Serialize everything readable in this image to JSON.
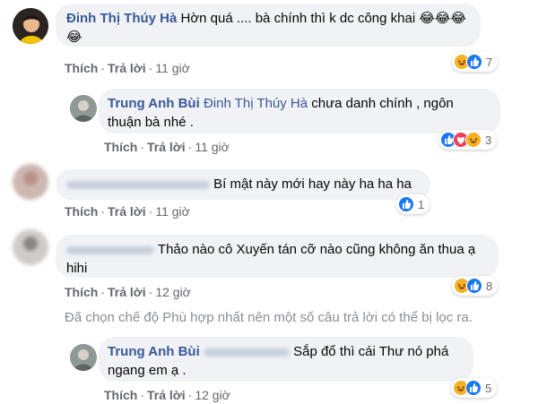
{
  "comments": [
    {
      "author": "Đinh Thị Thúy Hà",
      "text_line1": "Hờn quá .... bà chính thì k dc công khai",
      "emoji_text": "😂😂😂",
      "emoji_line2": "😂",
      "like": "Thích",
      "reply": "Trả lời",
      "time": "11 giờ",
      "reaction_icons": [
        "haha-icon",
        "like-icon"
      ],
      "reaction_count": "7"
    },
    {
      "author": "Trung Anh Bùi",
      "tagged": "Đinh Thị Thúy Hà",
      "text_line1": "chưa danh chính , ngôn",
      "text_line2": "thuận bà nhé .",
      "like": "Thích",
      "reply": "Trả lời",
      "time": "11 giờ",
      "reaction_icons": [
        "like-icon",
        "love-icon",
        "haha-icon"
      ],
      "reaction_count": "3"
    },
    {
      "author": "",
      "text_line1": "Bí mật này mới hay này ha ha ha",
      "like": "Thích",
      "reply": "Trả lời",
      "time": "11 giờ",
      "reaction_icons": [
        "like-icon"
      ],
      "reaction_count": "1"
    },
    {
      "author": "",
      "text_line1": "Thảo nào cô Xuyến tán cỡ nào cũng không ăn thua ạ",
      "text_line2": "hihi",
      "like": "Thích",
      "reply": "Trả lời",
      "time": "12 giờ",
      "reaction_icons": [
        "haha-icon",
        "like-icon"
      ],
      "reaction_count": "8"
    },
    {
      "author": "Trung Anh Bùi",
      "tagged": "",
      "text_line1": "Sắp đổ thì cái Thư nó phá",
      "text_line2": "ngang em ạ .",
      "like": "Thích",
      "reply": "Trả lời",
      "time": "12 giờ",
      "reaction_icons": [
        "haha-icon",
        "like-icon"
      ],
      "reaction_count": "5"
    }
  ],
  "filter_notice": "Đã chọn chế độ Phù hợp nhất nên một số câu trả lời có thể bị lọc ra.",
  "colors": {
    "link": "#385898",
    "bubble": "#f0f2f5",
    "meta": "#65676b",
    "like": "#1877f2",
    "love": "#f33e58",
    "haha": "#f7b125"
  }
}
